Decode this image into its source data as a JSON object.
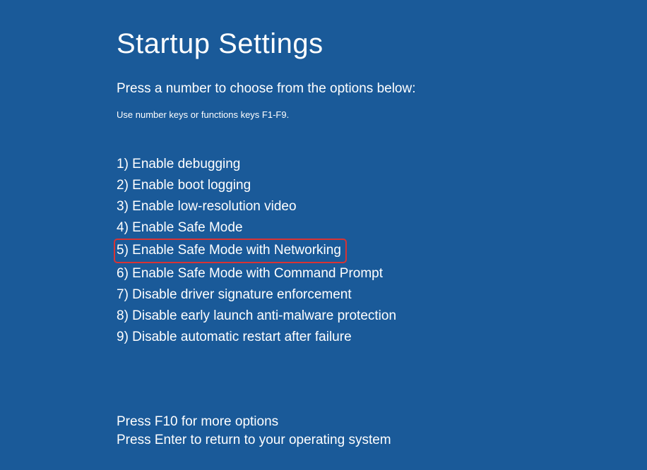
{
  "title": "Startup Settings",
  "subtitle": "Press a number to choose from the options below:",
  "instruction": "Use number keys or functions keys F1-F9.",
  "options": [
    "1) Enable debugging",
    "2) Enable boot logging",
    "3) Enable low-resolution video",
    "4) Enable Safe Mode",
    "5) Enable Safe Mode with Networking",
    "6) Enable Safe Mode with Command Prompt",
    "7) Disable driver signature enforcement",
    "8) Disable early launch anti-malware protection",
    "9) Disable automatic restart after failure"
  ],
  "highlighted_index": 4,
  "footer": {
    "more_options": "Press F10 for more options",
    "return": "Press Enter to return to your operating system"
  }
}
